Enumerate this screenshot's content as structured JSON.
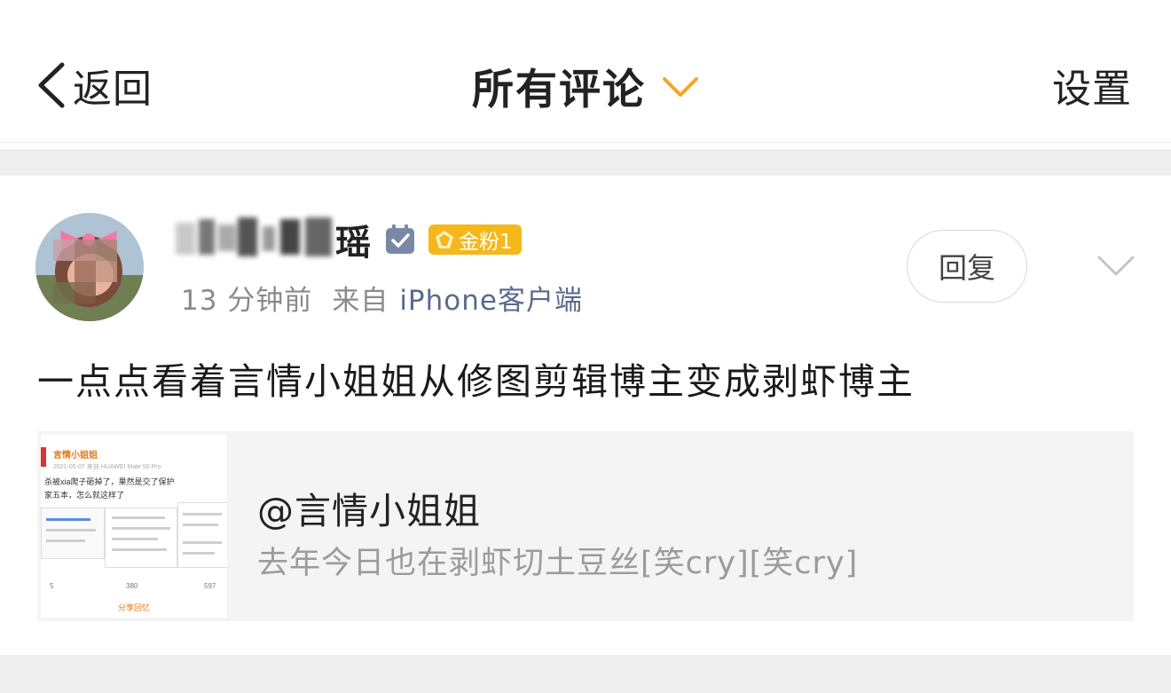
{
  "header": {
    "back_label": "返回",
    "title": "所有评论",
    "settings_label": "设置"
  },
  "comment": {
    "username_visible": "瑶",
    "badge_label": "金粉1",
    "time": "13 分钟前",
    "source_prefix": "来自",
    "source": "iPhone客户端",
    "reply_label": "回复",
    "text": "一点点看着言情小姐姐从修图剪辑博主变成剥虾博主"
  },
  "quoted_post": {
    "title": "@言情小姐姐",
    "text": "去年今日也在剥虾切土豆丝[笑cry][笑cry]",
    "thumbnail": {
      "author": "言情小姐姐",
      "date_device": "2021-05-07 来自 HUAWEI Mate 50 Pro",
      "line1": "杀被xia爬子砸掉了，果然是交了保护",
      "line2": "家五本，怎么就这样了",
      "repost_count": "5",
      "comment_count": "380",
      "like_count": "597",
      "share_label": "分享回忆"
    }
  },
  "colors": {
    "accent": "#f5a623",
    "badge": "#f5b71a",
    "source_link": "#5a6a8c",
    "secondary_text": "#8a8a8a"
  }
}
